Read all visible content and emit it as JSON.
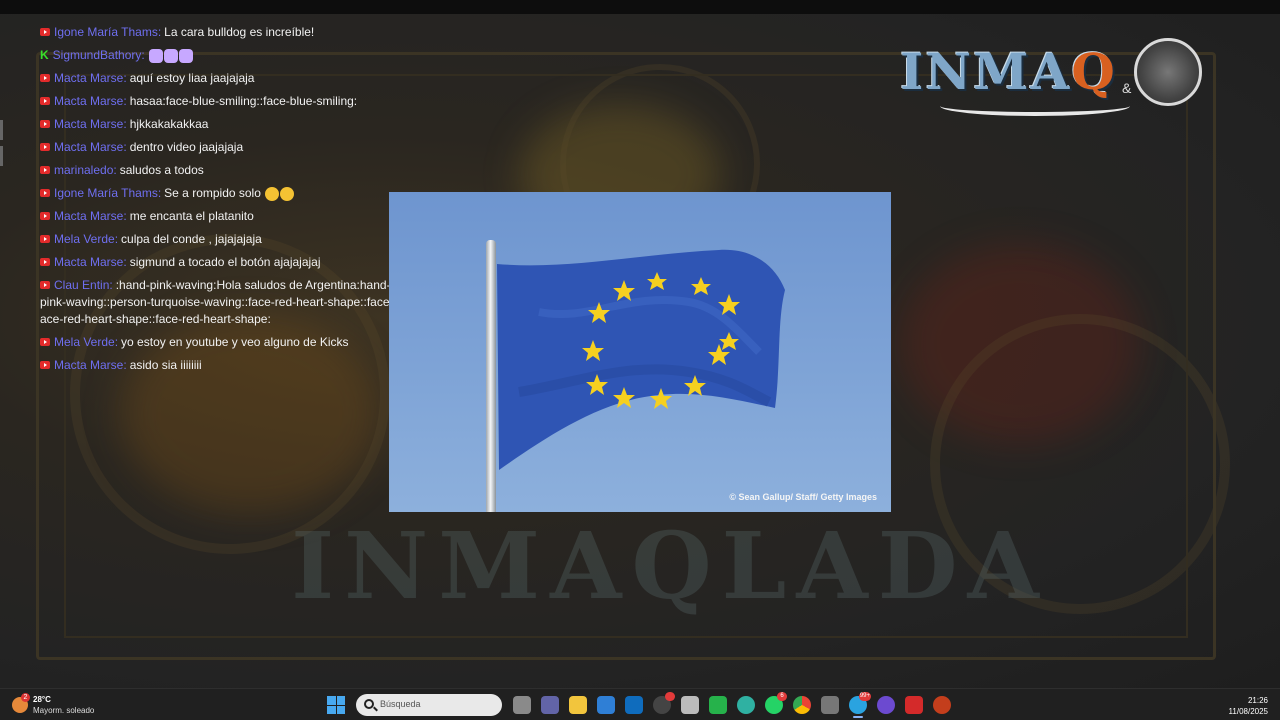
{
  "stream": {
    "watermark_text": "INMAQLADA",
    "logo": {
      "text_main": "INMA",
      "text_q": "Q",
      "text_amp": "&"
    }
  },
  "chat": {
    "messages": [
      {
        "platform": "youtube",
        "user": "Igone María Thams",
        "text": "La cara bulldog es increíble!"
      },
      {
        "platform": "kick",
        "user": "SigmundBathory",
        "text": ""
      },
      {
        "platform": "youtube",
        "user": "Macta Marse",
        "text": "aquí estoy liaa jaajajaja"
      },
      {
        "platform": "youtube",
        "user": "Macta Marse",
        "text": "hasaa:face-blue-smiling::face-blue-smiling:"
      },
      {
        "platform": "youtube",
        "user": "Macta Marse",
        "text": "hjkkakakakkaa"
      },
      {
        "platform": "youtube",
        "user": "Macta Marse",
        "text": "dentro video jaajajaja"
      },
      {
        "platform": "youtube",
        "user": "marinaledo",
        "text": "saludos a todos"
      },
      {
        "platform": "youtube",
        "user": "Igone María Thams",
        "text": "Se a rompido solo"
      },
      {
        "platform": "youtube",
        "user": "Macta Marse",
        "text": "me encanta el platanito"
      },
      {
        "platform": "youtube",
        "user": "Mela Verde",
        "text": "culpa del conde , jajajajaja"
      },
      {
        "platform": "youtube",
        "user": "Macta Marse",
        "text": "sigmund a tocado el botón ajajajajaj"
      },
      {
        "platform": "youtube",
        "user": "Clau Entin",
        "text": ":hand-pink-waving:Hola saludos de Argentina:hand-pink-waving::hand-pink-waving::person-turquoise-waving::face-red-heart-shape::face-red-heart-shape::face-red-heart-shape::face-red-heart-shape:"
      },
      {
        "platform": "youtube",
        "user": "Mela Verde",
        "text": "yo estoy en youtube y veo alguno de Kicks"
      },
      {
        "platform": "youtube",
        "user": "Macta Marse",
        "text": "asido sia iiiiiiii"
      }
    ]
  },
  "photo": {
    "credit": "© Sean Gallup/ Staff/ Getty Images",
    "subject": "European Union flag on flagpole",
    "colors": {
      "sky": "#7ea3d6",
      "flag": "#2f55b4",
      "stars": "#f5d020"
    }
  },
  "taskbar": {
    "weather": {
      "temp": "28°C",
      "desc": "Mayorm. soleado",
      "badge": "2"
    },
    "search_placeholder": "Búsqueda",
    "icons": [
      {
        "name": "start-icon"
      },
      {
        "name": "task-view-icon"
      },
      {
        "name": "teams-icon"
      },
      {
        "name": "file-explorer-icon"
      },
      {
        "name": "store-icon"
      },
      {
        "name": "outlook-icon"
      },
      {
        "name": "app-red-dot-icon"
      },
      {
        "name": "unity-icon"
      },
      {
        "name": "camtasia-icon"
      },
      {
        "name": "edge-icon"
      },
      {
        "name": "whatsapp-icon",
        "badge": "6"
      },
      {
        "name": "chrome-icon"
      },
      {
        "name": "settings-icon"
      },
      {
        "name": "telegram-icon",
        "badge": "99+"
      },
      {
        "name": "obs-icon"
      },
      {
        "name": "acrobat-icon"
      },
      {
        "name": "powerpoint-icon"
      }
    ],
    "clock": {
      "time": "21:26",
      "date": "11/08/2025"
    }
  }
}
